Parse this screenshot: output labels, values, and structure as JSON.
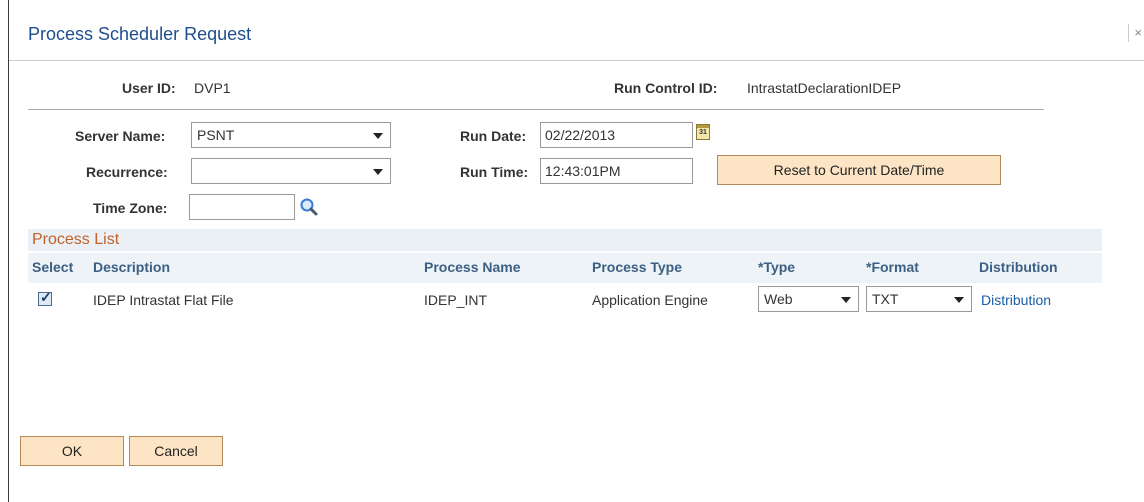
{
  "dialog": {
    "title": "Process Scheduler Request",
    "close_label": "×"
  },
  "header": {
    "user_id_label": "User ID:",
    "user_id_value": "DVP1",
    "run_control_label": "Run Control ID:",
    "run_control_value": "IntrastatDeclarationIDEP"
  },
  "form": {
    "server_name_label": "Server Name:",
    "server_name_value": "PSNT",
    "recurrence_label": "Recurrence:",
    "recurrence_value": "",
    "time_zone_label": "Time Zone:",
    "time_zone_value": "",
    "run_date_label": "Run Date:",
    "run_date_value": "02/22/2013",
    "calendar_icon_text": "31",
    "run_time_label": "Run Time:",
    "run_time_value": "12:43:01PM",
    "reset_button_label": "Reset to Current Date/Time"
  },
  "process_list": {
    "title": "Process List",
    "columns": {
      "select": "Select",
      "description": "Description",
      "process_name": "Process Name",
      "process_type": "Process Type",
      "type": "*Type",
      "format": "*Format",
      "distribution": "Distribution"
    },
    "rows": [
      {
        "selected": true,
        "description": "IDEP Intrastat Flat File",
        "process_name": "IDEP_INT",
        "process_type": "Application Engine",
        "type": "Web",
        "format": "TXT",
        "distribution": "Distribution"
      }
    ]
  },
  "footer": {
    "ok_label": "OK",
    "cancel_label": "Cancel"
  },
  "colors": {
    "title": "#1f4e8c",
    "section_title": "#c0622a",
    "column_header": "#3c5f83",
    "link": "#1a5ea8",
    "button_bg": "#fce4c4"
  }
}
